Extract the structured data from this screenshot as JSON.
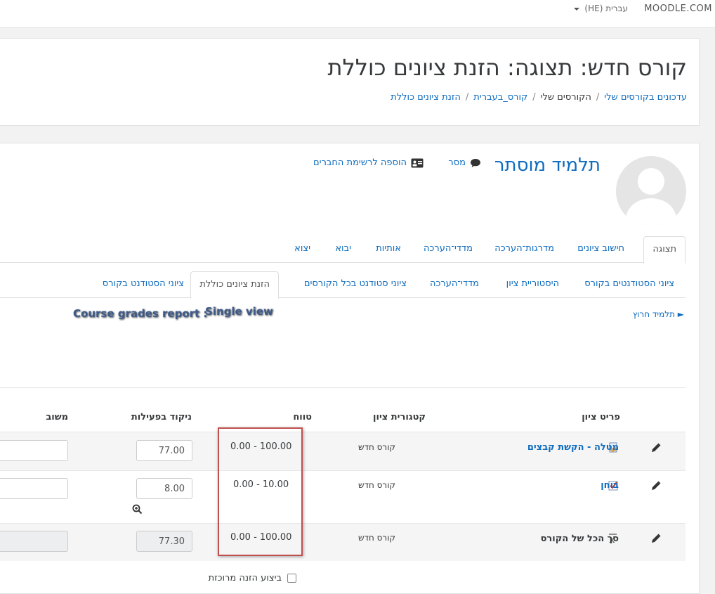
{
  "topbar": {
    "brand": "MOODLE.COM",
    "language": "עברית (HE)"
  },
  "header": {
    "title": "קורס חדש: תצוגה: הזנת ציונים כוללת",
    "breadcrumb": [
      "עדכונים בקורסים שלי",
      "הקורסים שלי",
      "קורס_בעברית",
      "הזנת ציונים כוללת"
    ]
  },
  "user": {
    "name": "תלמיד מוסתר",
    "message_label": "מסר",
    "add_contact_label": "הוספה לרשימת החברים"
  },
  "tabs_primary": [
    "תצוגה",
    "חישוב ציונים",
    "מדרגות־הערכה",
    "מדדי־הערכה",
    "אותיות",
    "יבוא",
    "יצוא"
  ],
  "tabs_secondary": [
    "ציוני הסטודנטים בקורס",
    "היסטוריית ציון",
    "מדדי־הערכה",
    "ציוני סטודנט בכל הקורסים",
    "הזנת ציונים כוללת",
    "ציוני הסטודנט בקורס"
  ],
  "collapse_link": "► תלמיד חרוץ",
  "overlay": {
    "label1": "Course grades report :",
    "label2": "Single view"
  },
  "table": {
    "headers": {
      "item": "פריט ציון",
      "category": "קטגורית ציון",
      "range": "טווח",
      "grade": "ניקוד בפעילות",
      "feedback": "משוב"
    },
    "rows": [
      {
        "item": "מטלה - הקשת קבצים",
        "category": "קורס חדש",
        "range": "0.00 - 100.00",
        "grade": "77.00"
      },
      {
        "item": "בוחן",
        "category": "קורס חדש",
        "range": "0.00 - 10.00",
        "grade": "8.00"
      },
      {
        "item": "סך הכל של הקורס",
        "category": "קורס חדש",
        "range": "0.00 - 100.00",
        "grade": "77.30"
      }
    ]
  },
  "bulk_label": "ביצוע הזנה מרוכזת",
  "colors": {
    "link": "#0f6cbf",
    "highlight_box": "#c0504d"
  }
}
